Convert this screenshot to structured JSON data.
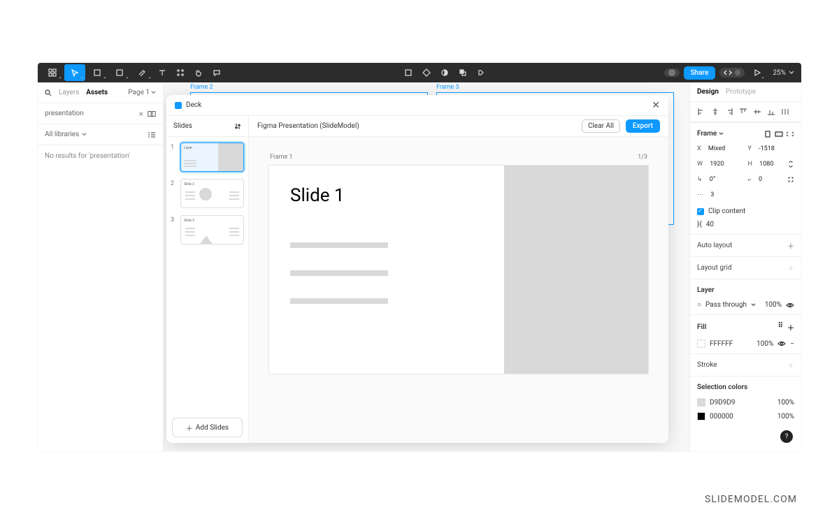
{
  "topbar": {
    "share": "Share",
    "zoom": "25%"
  },
  "left": {
    "tab_layers": "Layers",
    "tab_assets": "Assets",
    "page": "Page 1",
    "search_value": "presentation",
    "all_libraries": "All libraries",
    "no_results": "No results for 'presentation'"
  },
  "canvas": {
    "frame2": "Frame 2",
    "frame3": "Frame 3"
  },
  "deck": {
    "title": "Deck",
    "slides_header": "Slides",
    "presentation_name": "Figma Presentation (SlideModel)",
    "clear_all": "Clear All",
    "export": "Export",
    "frame_label": "Frame 1",
    "counter": "1/3",
    "slide_title": "Slide 1",
    "add_slides": "Add Slides",
    "thumbs": [
      {
        "num": "1",
        "label": "Layer"
      },
      {
        "num": "2",
        "label": "Slide 2"
      },
      {
        "num": "3",
        "label": "Slide 3"
      }
    ]
  },
  "right": {
    "tab_design": "Design",
    "tab_prototype": "Prototype",
    "frame": "Frame",
    "x_label": "X",
    "x_val": "Mixed",
    "y_label": "Y",
    "y_val": "-1518",
    "w_label": "W",
    "w_val": "1920",
    "h_label": "H",
    "h_val": "1080",
    "rot_label": "↳",
    "rot_val": "0°",
    "rad_label": "⌐",
    "rad_val": "0",
    "gap_val": "3",
    "clip": "Clip content",
    "constraint_val": "40",
    "auto_layout": "Auto layout",
    "layout_grid": "Layout grid",
    "layer": "Layer",
    "blend": "Pass through",
    "layer_opacity": "100%",
    "fill": "Fill",
    "fill_hex": "FFFFFF",
    "fill_opacity": "100%",
    "stroke": "Stroke",
    "sel_colors": "Selection colors",
    "sel": [
      {
        "hex": "D9D9D9",
        "pct": "100%"
      },
      {
        "hex": "000000",
        "pct": "100%"
      }
    ]
  },
  "watermark": "SLIDEMODEL.COM"
}
